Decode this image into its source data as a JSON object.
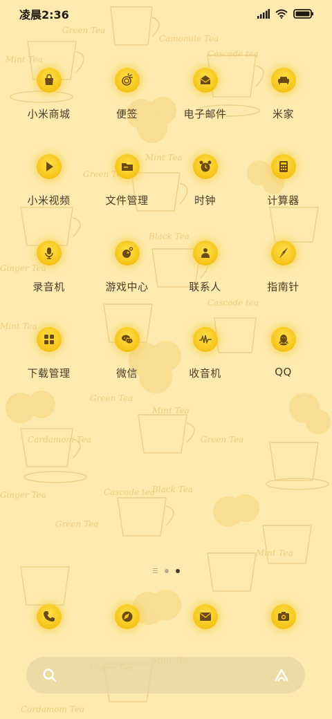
{
  "status_bar": {
    "time": "凌晨2:36",
    "icons": [
      "signal-icon",
      "wifi-icon",
      "battery-icon"
    ]
  },
  "wallpaper": {
    "words": [
      "Green Tea",
      "Mint Tea",
      "Black Tea",
      "Ginger Tea",
      "Cascade tea",
      "Cardamom Tea",
      "Camomile Tea"
    ]
  },
  "apps": [
    {
      "label": "小米商城",
      "icon": "shopping-bag-icon"
    },
    {
      "label": "便签",
      "icon": "notes-icon"
    },
    {
      "label": "电子邮件",
      "icon": "email-icon"
    },
    {
      "label": "米家",
      "icon": "sofa-icon"
    },
    {
      "label": "小米视频",
      "icon": "play-icon"
    },
    {
      "label": "文件管理",
      "icon": "folder-icon"
    },
    {
      "label": "时钟",
      "icon": "alarm-clock-icon"
    },
    {
      "label": "计算器",
      "icon": "calculator-icon"
    },
    {
      "label": "录音机",
      "icon": "microphone-icon"
    },
    {
      "label": "游戏中心",
      "icon": "game-icon"
    },
    {
      "label": "联系人",
      "icon": "contact-icon"
    },
    {
      "label": "指南针",
      "icon": "compass-icon"
    },
    {
      "label": "下载管理",
      "icon": "download-grid-icon"
    },
    {
      "label": "微信",
      "icon": "wechat-icon"
    },
    {
      "label": "收音机",
      "icon": "radio-wave-icon"
    },
    {
      "label": "QQ",
      "icon": "qq-penguin-icon"
    }
  ],
  "page_indicator": {
    "pages": 2,
    "active": 2
  },
  "dock": [
    {
      "icon": "phone-icon"
    },
    {
      "icon": "browser-icon"
    },
    {
      "icon": "messages-icon"
    },
    {
      "icon": "camera-icon"
    }
  ],
  "search_bar": {
    "left_icon": "search-icon",
    "right_icon": "assistant-icon"
  },
  "colors": {
    "background": "#fdeaae",
    "icon_yellow": "#f6c51b",
    "icon_glyph": "#6b4a14",
    "label_text": "#4a3d25"
  }
}
